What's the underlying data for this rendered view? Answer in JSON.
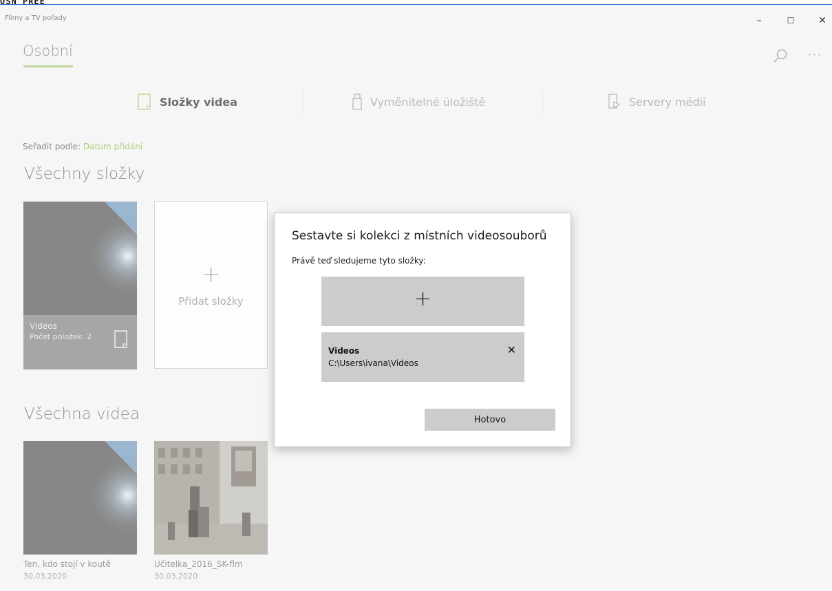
{
  "top_cut_text": "OSN PREE",
  "window": {
    "app_title": "Filmy a TV pořady",
    "minimize": "–",
    "maximize": "☐",
    "close": "✕"
  },
  "header": {
    "personal_tab": "Osobní",
    "more": "···",
    "accent_color": "#c2d79d"
  },
  "pivot": {
    "items": [
      {
        "label": "Složky videa",
        "icon": "folder-icon"
      },
      {
        "label": "Vyměnitelné úložiště",
        "icon": "usb-drive-icon"
      },
      {
        "label": "Servery médií",
        "icon": "media-server-icon"
      }
    ]
  },
  "sort": {
    "label": "Seřadit podle:",
    "value": "Datum přidání"
  },
  "folders_section": {
    "title": "Všechny složky",
    "folder": {
      "name": "Videos",
      "count": "Počet položek: 2"
    },
    "add_label": "Přidat složky",
    "add_plus": "+"
  },
  "videos_section": {
    "title": "Všechna videa",
    "items": [
      {
        "title": "Ten, kdo stojí v koutě",
        "date": "30.03.2020"
      },
      {
        "title": "Učitelka_2016_SK-flm",
        "date": "30.03.2020"
      }
    ]
  },
  "dialog": {
    "title": "Sestavte si kolekci z místních videosouborů",
    "subtitle": "Právě teď sledujeme tyto složky:",
    "add_plus": "+",
    "folder": {
      "name": "Videos",
      "path": "C:\\Users\\ivana\\Videos",
      "remove": "✕"
    },
    "done_label": "Hotovo"
  }
}
